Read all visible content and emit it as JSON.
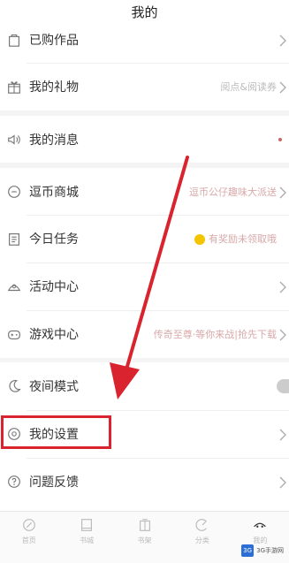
{
  "header": {
    "title": "我的"
  },
  "menu": {
    "purchased": {
      "label": "已购作品"
    },
    "gifts": {
      "label": "我的礼物",
      "right": "阅点&阅读券"
    },
    "messages": {
      "label": "我的消息"
    },
    "shop": {
      "label": "逗币商城",
      "right": "逗币公仔趣味大派送"
    },
    "tasks": {
      "label": "今日任务",
      "right": "有奖励未领取哦"
    },
    "events": {
      "label": "活动中心"
    },
    "games": {
      "label": "游戏中心",
      "right": "传奇至尊·等你来战|抢先下载"
    },
    "night": {
      "label": "夜间模式"
    },
    "settings": {
      "label": "我的设置"
    },
    "feedback": {
      "label": "问题反馈"
    }
  },
  "tabs": [
    {
      "label": "首页"
    },
    {
      "label": "书城"
    },
    {
      "label": "书架"
    },
    {
      "label": "分类"
    },
    {
      "label": "我的"
    }
  ],
  "watermark": {
    "text": "3G手游网",
    "logo": "3G"
  },
  "colors": {
    "highlight": "#d9242f",
    "accent": "#f5c400"
  }
}
